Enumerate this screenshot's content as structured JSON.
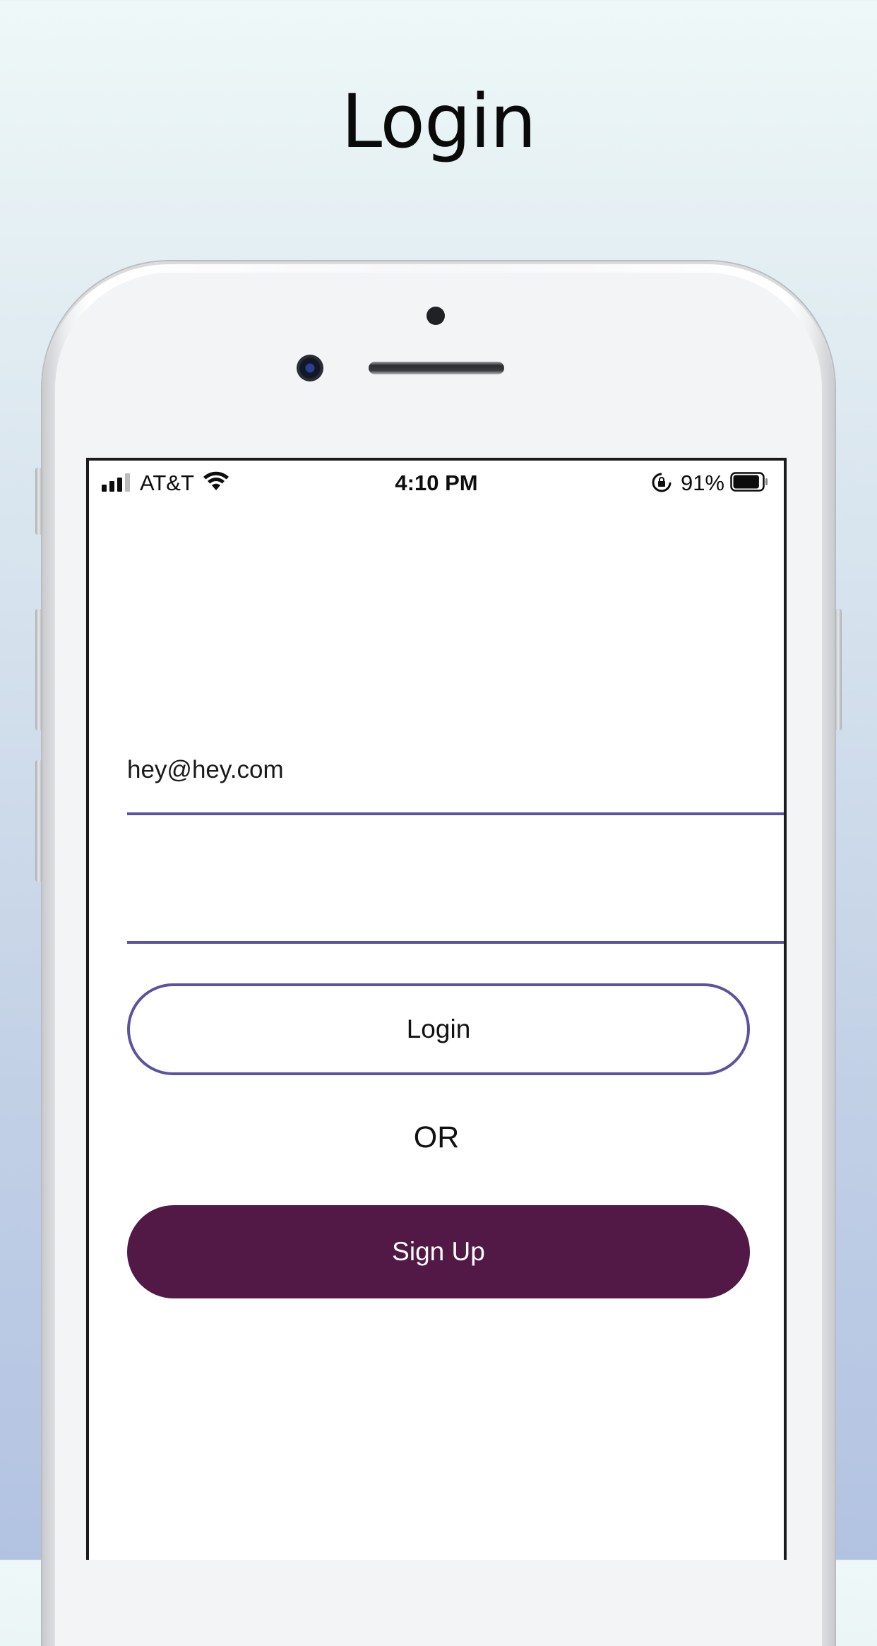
{
  "headline": "Login",
  "status_bar": {
    "carrier": "AT&T",
    "time": "4:10 PM",
    "battery_percent": "91%",
    "battery_level": 0.91,
    "icons": [
      "cellular-signal-icon",
      "wifi-icon",
      "orientation-lock-icon",
      "battery-icon"
    ]
  },
  "form": {
    "email_value": "hey@hey.com",
    "password_value": ""
  },
  "buttons": {
    "login_label": "Login",
    "separator": "OR",
    "signup_label": "Sign Up"
  },
  "colors": {
    "accent": "#5b52a0",
    "signup_bg": "#521846"
  }
}
